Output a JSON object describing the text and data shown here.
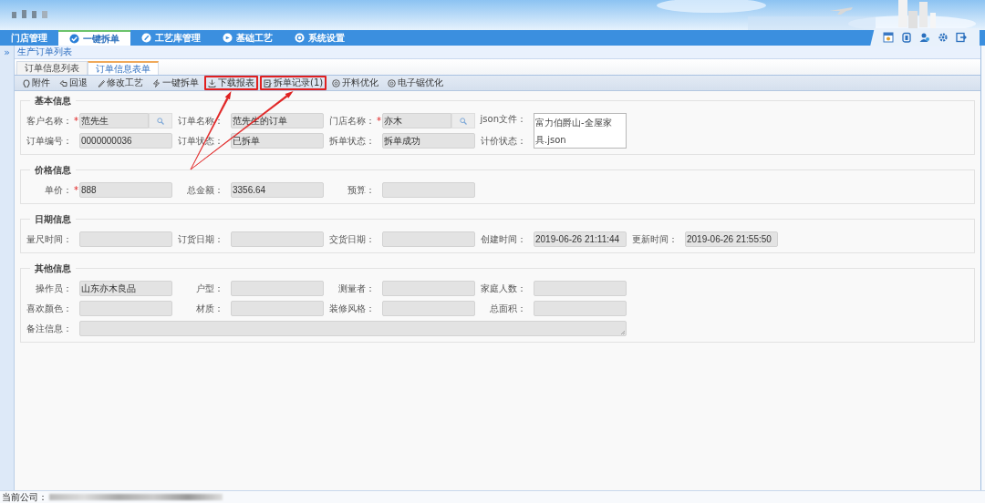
{
  "nav": {
    "tabs": [
      {
        "label": "门店管理",
        "selected": false
      },
      {
        "label": "一键拆单",
        "selected": true
      },
      {
        "label": "工艺库管理",
        "selected": false
      },
      {
        "label": "基础工艺",
        "selected": false
      },
      {
        "label": "系统设置",
        "selected": false
      }
    ]
  },
  "sidebar": {
    "toggle": "»"
  },
  "breadcrumb": "生产订单列表",
  "subtabs": [
    {
      "label": "订单信息列表",
      "selected": false
    },
    {
      "label": "订单信息表单",
      "selected": true
    }
  ],
  "toolbar": [
    {
      "label": "附件",
      "highlighted": false
    },
    {
      "label": "回退",
      "highlighted": false
    },
    {
      "label": "修改工艺",
      "highlighted": false
    },
    {
      "label": "一键拆单",
      "highlighted": false
    },
    {
      "label": "下载报表",
      "highlighted": true
    },
    {
      "label": "拆单记录(1)",
      "highlighted": true
    },
    {
      "label": "开料优化",
      "highlighted": false
    },
    {
      "label": "电子锯优化",
      "highlighted": false
    }
  ],
  "sections": [
    {
      "title": "基本信息",
      "rows": [
        [
          {
            "label": "客户名称：",
            "marker": "*",
            "kind": "lookup",
            "value": "范先生"
          },
          {
            "label": "订单名称：",
            "kind": "text",
            "value": "范先生的订单"
          },
          {
            "label": "门店名称：",
            "marker": "*",
            "kind": "lookup",
            "value": "亦木"
          },
          {
            "label": "json文件：",
            "kind": "file",
            "value": "富力伯爵山-全屋家具.json"
          }
        ],
        [
          {
            "label": "订单编号：",
            "kind": "text",
            "value": "0000000036"
          },
          {
            "label": "订单状态：",
            "kind": "text",
            "value": "已拆单"
          },
          {
            "label": "拆单状态：",
            "kind": "text",
            "value": "拆单成功"
          },
          {
            "label": "计价状态：",
            "kind": "text"
          }
        ]
      ]
    },
    {
      "title": "价格信息",
      "rows": [
        [
          {
            "label": "单价：",
            "marker": "*",
            "kind": "text",
            "value": "888"
          },
          {
            "label": "总金额：",
            "kind": "text",
            "value": "3356.64"
          },
          {
            "label": "预算：",
            "kind": "text"
          }
        ]
      ]
    },
    {
      "title": "日期信息",
      "rows": [
        [
          {
            "label": "量尺时间：",
            "kind": "text"
          },
          {
            "label": "订货日期：",
            "kind": "text"
          },
          {
            "label": "交货日期：",
            "kind": "text"
          },
          {
            "label": "创建时间：",
            "kind": "text",
            "value": "2019-06-26 21:11:44"
          },
          {
            "label": "更新时间：",
            "kind": "text",
            "value": "2019-06-26 21:55:50"
          }
        ]
      ]
    },
    {
      "title": "其他信息",
      "rows": [
        [
          {
            "label": "操作员：",
            "kind": "text",
            "value": "山东亦木良品"
          },
          {
            "label": "户型：",
            "kind": "text"
          },
          {
            "label": "测量者：",
            "kind": "text"
          },
          {
            "label": "家庭人数：",
            "kind": "text"
          }
        ],
        [
          {
            "label": "喜欢颜色：",
            "kind": "text"
          },
          {
            "label": "材质：",
            "kind": "text"
          },
          {
            "label": "装修风格：",
            "kind": "text"
          },
          {
            "label": "总面积：",
            "kind": "text"
          }
        ],
        [
          {
            "label": "备注信息：",
            "kind": "textarea"
          }
        ]
      ]
    }
  ],
  "status_bar": {
    "label": "当前公司："
  }
}
